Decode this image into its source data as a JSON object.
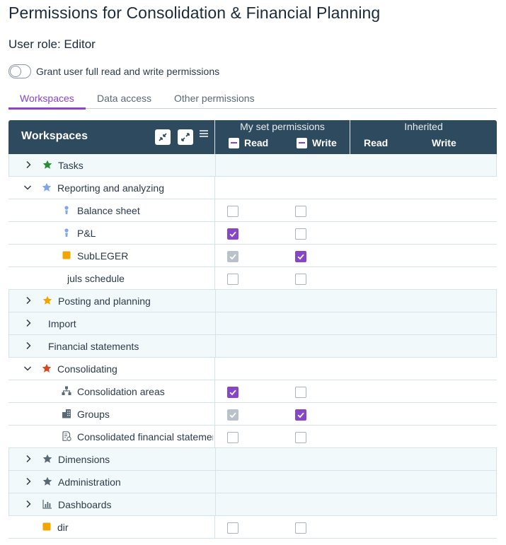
{
  "page": {
    "title": "Permissions for Consolidation & Financial Planning",
    "role": "User role: Editor"
  },
  "toggle": {
    "label": "Grant user full read and write permissions",
    "on": false
  },
  "tabs": [
    {
      "label": "Workspaces",
      "active": true
    },
    {
      "label": "Data access",
      "active": false
    },
    {
      "label": "Other permissions",
      "active": false
    }
  ],
  "grid": {
    "title": "Workspaces",
    "group_set": "My set permissions",
    "group_inherited": "Inherited",
    "col_read": "Read",
    "col_write": "Write",
    "col_inh_read": "Read",
    "col_inh_write": "Write"
  },
  "colors": {
    "accent": "#8a44c8",
    "header_bg": "#2e4a5e",
    "band_bg": "#f2f9fb"
  },
  "rows": [
    {
      "label": "Tasks",
      "chevron": "right",
      "icon": "star-icon",
      "icon_color": "#2e8b3a",
      "read": null,
      "write": null
    },
    {
      "label": "Reporting and analyzing",
      "chevron": "down",
      "icon": "star-icon",
      "icon_color": "#7ea6e8",
      "read": null,
      "write": null
    },
    {
      "label": "Balance sheet",
      "chevron": "",
      "icon": "person-icon",
      "icon_color": "#7ea6e8",
      "read": "off",
      "write": "off"
    },
    {
      "label": "P&L",
      "chevron": "",
      "icon": "person-icon",
      "icon_color": "#7ea6e8",
      "read": "on",
      "write": "off"
    },
    {
      "label": "SubLEGER",
      "chevron": "",
      "icon": "square-icon",
      "icon_color": "#f0a500",
      "read": "dim",
      "write": "on"
    },
    {
      "label": "juls schedule",
      "chevron": "",
      "icon": "",
      "icon_color": "",
      "read": "off",
      "write": "off"
    },
    {
      "label": "Posting and planning",
      "chevron": "right",
      "icon": "star-icon",
      "icon_color": "#f0a500",
      "read": null,
      "write": null
    },
    {
      "label": "Import",
      "chevron": "right",
      "icon": "",
      "icon_color": "",
      "read": null,
      "write": null
    },
    {
      "label": "Financial statements",
      "chevron": "right",
      "icon": "",
      "icon_color": "",
      "read": null,
      "write": null
    },
    {
      "label": "Consolidating",
      "chevron": "down",
      "icon": "star-icon",
      "icon_color": "#d9471f",
      "read": null,
      "write": null
    },
    {
      "label": "Consolidation areas",
      "chevron": "",
      "icon": "hierarchy-icon",
      "icon_color": "#5a6876",
      "read": "on",
      "write": "off"
    },
    {
      "label": "Groups",
      "chevron": "",
      "icon": "building-icon",
      "icon_color": "#5a6876",
      "read": "dim",
      "write": "on"
    },
    {
      "label": "Consolidated financial statements",
      "chevron": "",
      "icon": "report-icon",
      "icon_color": "#5a6876",
      "read": "off",
      "write": "off"
    },
    {
      "label": "Dimensions",
      "chevron": "right",
      "icon": "star-icon",
      "icon_color": "#5a6876",
      "read": null,
      "write": null
    },
    {
      "label": "Administration",
      "chevron": "right",
      "icon": "star-icon",
      "icon_color": "#5a6876",
      "read": null,
      "write": null
    },
    {
      "label": "Dashboards",
      "chevron": "right",
      "icon": "chart-icon",
      "icon_color": "#5a6876",
      "read": null,
      "write": null
    },
    {
      "label": "dir",
      "chevron": "",
      "icon": "square-icon",
      "icon_color": "#f0a500",
      "read": "off",
      "write": "off"
    }
  ]
}
